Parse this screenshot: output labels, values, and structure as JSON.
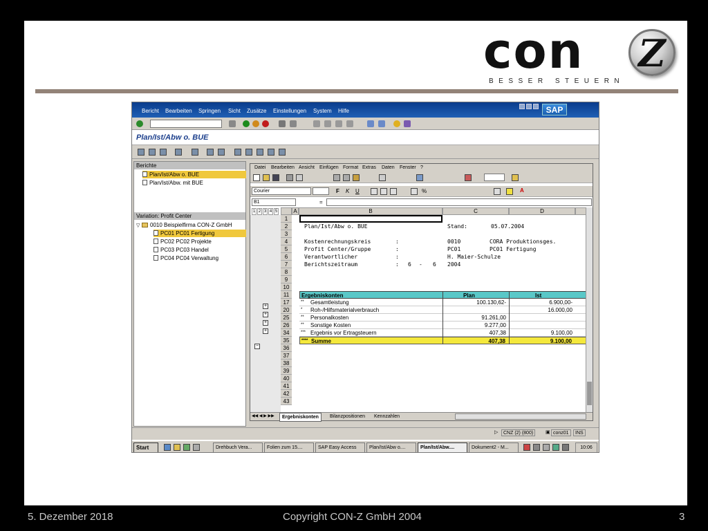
{
  "slide": {
    "logo_text": "con",
    "logo_letter": "Z",
    "logo_tagline": "BESSER STEUERN",
    "footer_date": "5. Dezember 2018",
    "footer_copyright": "Copyright CON-Z GmbH 2004",
    "footer_page": "3"
  },
  "sap": {
    "menu": [
      "Bericht",
      "Bearbeiten",
      "Springen",
      "Sicht",
      "Zusätze",
      "Einstellungen",
      "System",
      "Hilfe"
    ],
    "brand": "SAP",
    "title": "Plan/Ist/Abw o. BUE",
    "reports_header": "Berichte",
    "reports": [
      "Plan/Ist/Abw o. BUE",
      "Plan/Ist/Abw. mit BUE"
    ],
    "variation_header": "Variation: Profit Center",
    "tree_root": "0010 Beispielfirma CON-Z GmbH",
    "tree_items": [
      "PC01 PC01 Fertigung",
      "PC02 PC02 Projekte",
      "PC03 PC03 Handel",
      "PC04 PC04 Verwaltung"
    ]
  },
  "excel": {
    "menu": [
      "Datei",
      "Bearbeiten",
      "Ansicht",
      "Einfügen",
      "Format",
      "Extras",
      "Daten",
      "Fenster",
      "?"
    ],
    "font": "Courier",
    "namebox": "B1",
    "formula_sign": "=",
    "outline_levels": [
      "1",
      "2",
      "3",
      "4",
      "5"
    ],
    "columns": [
      "A",
      "B",
      "C",
      "D"
    ],
    "row_numbers": [
      "1",
      "2",
      "3",
      "4",
      "5",
      "6",
      "7",
      "8",
      "9",
      "10",
      "11",
      "17",
      "20",
      "25",
      "26",
      "34",
      "35",
      "36",
      "37",
      "38",
      "39",
      "40",
      "41",
      "42",
      "43"
    ],
    "header_block": {
      "report_title": "Plan/Ist/Abw o. BUE",
      "stand_label": "Stand:",
      "stand_value": "05.07.2004",
      "r4_label": "Kostenrechnungskreis",
      "r4_colon": ":",
      "r4_code": "0010",
      "r4_desc": "CORA Produktionsges.",
      "r5_label": "Profit Center/Gruppe",
      "r5_colon": ":",
      "r5_code": "PC01",
      "r5_desc": "PC01 Fertigung",
      "r6_label": "Verantwortlicher",
      "r6_colon": ":",
      "r6_code": "H. Maier-Schulze",
      "r7_label": "Berichtszeitraum",
      "r7_colon": ":",
      "r7_from": "6",
      "r7_dash": "-",
      "r7_to": "6",
      "r7_year": "2004"
    },
    "table": {
      "headers": [
        "Ergebniskonten",
        "Plan",
        "Ist"
      ],
      "rows": [
        {
          "marker": "**",
          "label": "Gesamtleistung",
          "plan": "100.130,62-",
          "ist": "6.900,00-"
        },
        {
          "marker": "*",
          "label": "Roh-/Hilfsmaterialverbrauch",
          "plan": "",
          "ist": "16.000,00"
        },
        {
          "marker": "**",
          "label": "Personalkosten",
          "plan": "91.261,00",
          "ist": ""
        },
        {
          "marker": "**",
          "label": "Sonstige Kosten",
          "plan": "9.277,00",
          "ist": ""
        },
        {
          "marker": "***",
          "label": "Ergebnis vor Ertragsteuern",
          "plan": "407,38",
          "ist": "9.100,00"
        }
      ],
      "sum": {
        "marker": "****",
        "label": "Summe",
        "plan": "407,38",
        "ist": "9.100,00"
      }
    },
    "sheet_tabs": [
      "Ergebniskonten",
      "Bilanzpositionen",
      "Kennzahlen"
    ]
  },
  "status": {
    "system": "CNZ (2) (800)",
    "user": "conz01",
    "mode": "INS"
  },
  "taskbar": {
    "start": "Start",
    "items": [
      "Drehbuch Vera...",
      "Folien zum 15....",
      "SAP Easy Access",
      "Plan/Ist/Abw o....",
      "Plan/Ist/Abw....",
      "Dokument2 - M..."
    ],
    "clock": "10:06"
  }
}
